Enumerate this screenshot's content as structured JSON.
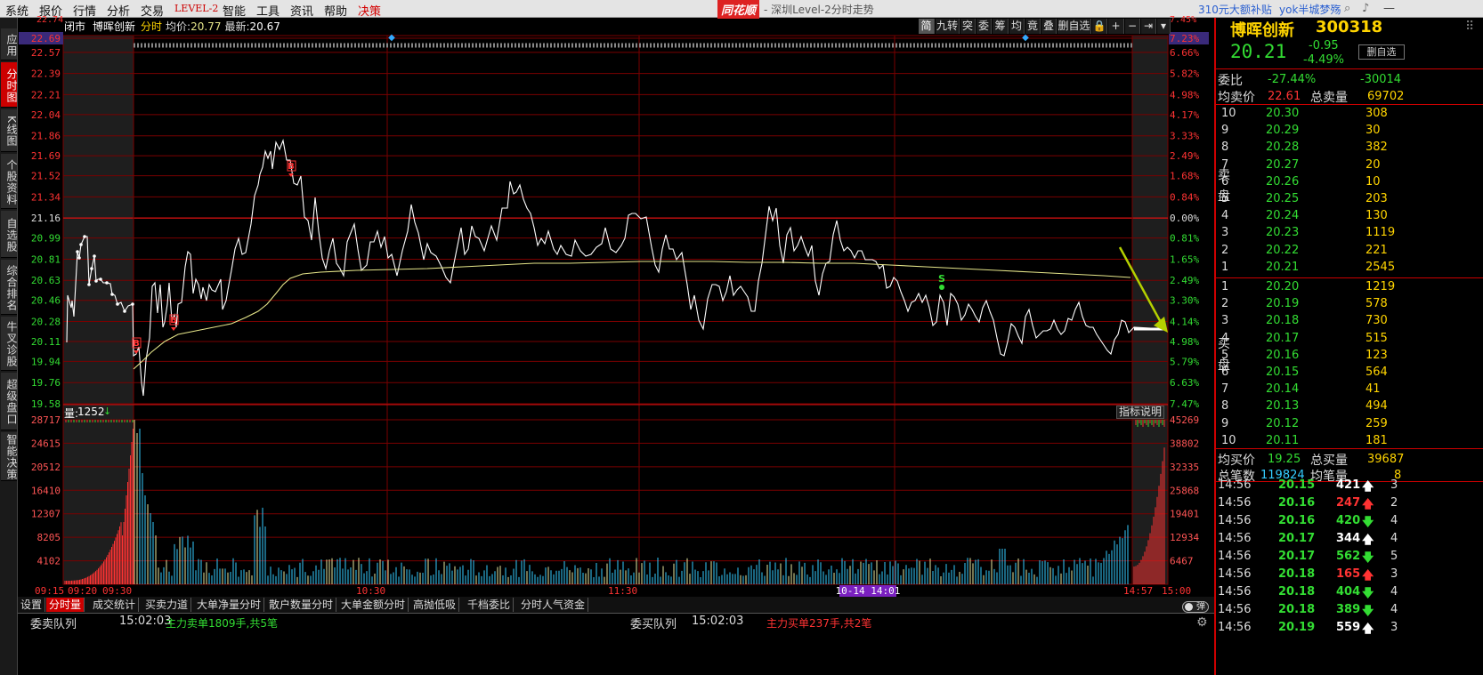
{
  "menu": {
    "items": [
      "系统",
      "报价",
      "行情",
      "分析",
      "交易",
      "LEVEL-2",
      "智能",
      "工具",
      "资讯",
      "帮助",
      "决策"
    ],
    "logo": "同花顺",
    "title": "深圳Level-2分时走势",
    "promo": "310元大额补贴",
    "user": "yok半城梦殇"
  },
  "left_tabs": [
    "应用",
    "分时图",
    "K线图",
    "个股资料",
    "自选股",
    "综合排名",
    "牛叉诊股",
    "超级盘口",
    "智能决策"
  ],
  "chart_header": {
    "session": "闭市",
    "name": "博晖创新",
    "mode": "分时",
    "avg_label": "均价:",
    "avg_value": "20.77",
    "latest_label": "最新:",
    "latest_value": "20.67"
  },
  "toolbar": [
    "简",
    "九转",
    "突",
    "委",
    "筹",
    "均",
    "竟",
    "叠",
    "删自选",
    "🔒",
    "+",
    "−",
    "⇥",
    "▾"
  ],
  "price_axis": {
    "prices": [
      "22.69",
      "22.57",
      "22.39",
      "22.21",
      "22.04",
      "21.86",
      "21.69",
      "21.52",
      "21.34",
      "21.16",
      "20.99",
      "20.81",
      "20.63",
      "20.46",
      "20.28",
      "20.11",
      "19.94",
      "19.76",
      "19.58"
    ],
    "percents": [
      "7.23%",
      "6.66%",
      "5.82%",
      "4.98%",
      "4.17%",
      "3.33%",
      "2.49%",
      "1.68%",
      "0.84%",
      "0.00%",
      "0.81%",
      "1.65%",
      "2.49%",
      "3.30%",
      "4.14%",
      "4.98%",
      "5.79%",
      "6.63%",
      "7.47%"
    ],
    "top_partial_left": "22.74",
    "top_partial_right": "7.45%"
  },
  "volume_axis": {
    "label": "量:",
    "value": "1252",
    "indicator_btn": "指标说明",
    "left": [
      "28717",
      "24615",
      "20512",
      "16410",
      "12307",
      "8205",
      "4102"
    ],
    "right": [
      "45269",
      "38802",
      "32335",
      "25868",
      "19401",
      "12934",
      "6467"
    ]
  },
  "time_axis": [
    "09:15",
    "09:20",
    "09:30",
    "10:30",
    "11:30",
    "14:57",
    "15:00"
  ],
  "time_cursor": "10-14 14:01",
  "markers": {
    "buy": "B",
    "sell": "S"
  },
  "bottom_tabs": [
    "设置",
    "分时量",
    "成交统计",
    "买卖力道",
    "大单净量分时",
    "散户数量分时",
    "大单金额分时",
    "高抛低吸",
    "千档委比",
    "分时人气资金"
  ],
  "queue": {
    "sell_title": "委卖队列",
    "sell_time": "15:02:03",
    "sell_info": "主力卖单1809手,共5笔",
    "buy_title": "委买队列",
    "buy_time": "15:02:03",
    "buy_info": "主力买单237手,共2笔",
    "toggle": "弹"
  },
  "quote": {
    "name": "博晖创新",
    "code": "300318",
    "price": "20.21",
    "change": "-0.95",
    "change_pct": "-4.49%",
    "btn": "删自选",
    "wei_bi_label": "委比",
    "wei_bi_value": "-27.44%",
    "wei_cha_value": "-30014",
    "avg_sell_label": "均卖价",
    "avg_sell_value": "22.61",
    "total_sell_label": "总卖量",
    "total_sell_value": "69702",
    "sell_side_label": "卖盘",
    "buy_side_label": "买盘",
    "sells": [
      {
        "lvl": "10",
        "price": "20.30",
        "vol": "308"
      },
      {
        "lvl": "9",
        "price": "20.29",
        "vol": "30"
      },
      {
        "lvl": "8",
        "price": "20.28",
        "vol": "382"
      },
      {
        "lvl": "7",
        "price": "20.27",
        "vol": "20"
      },
      {
        "lvl": "6",
        "price": "20.26",
        "vol": "10"
      },
      {
        "lvl": "5",
        "price": "20.25",
        "vol": "203"
      },
      {
        "lvl": "4",
        "price": "20.24",
        "vol": "130"
      },
      {
        "lvl": "3",
        "price": "20.23",
        "vol": "1119"
      },
      {
        "lvl": "2",
        "price": "20.22",
        "vol": "221"
      },
      {
        "lvl": "1",
        "price": "20.21",
        "vol": "2545"
      }
    ],
    "buys": [
      {
        "lvl": "1",
        "price": "20.20",
        "vol": "1219"
      },
      {
        "lvl": "2",
        "price": "20.19",
        "vol": "578"
      },
      {
        "lvl": "3",
        "price": "20.18",
        "vol": "730"
      },
      {
        "lvl": "4",
        "price": "20.17",
        "vol": "515"
      },
      {
        "lvl": "5",
        "price": "20.16",
        "vol": "123"
      },
      {
        "lvl": "6",
        "price": "20.15",
        "vol": "564"
      },
      {
        "lvl": "7",
        "price": "20.14",
        "vol": "41"
      },
      {
        "lvl": "8",
        "price": "20.13",
        "vol": "494"
      },
      {
        "lvl": "9",
        "price": "20.12",
        "vol": "259"
      },
      {
        "lvl": "10",
        "price": "20.11",
        "vol": "181"
      }
    ],
    "avg_buy_label": "均买价",
    "avg_buy_value": "19.25",
    "total_buy_label": "总买量",
    "total_buy_value": "39687",
    "total_trades_label": "总笔数",
    "total_trades_value": "119824",
    "avg_per_trade_label": "均笔量",
    "avg_per_trade_value": "8"
  },
  "ticks": [
    {
      "time": "14:56",
      "price": "20.15",
      "vol": "421",
      "dir": "up",
      "cnt": "3",
      "color": "#ffffff"
    },
    {
      "time": "14:56",
      "price": "20.16",
      "vol": "247",
      "dir": "up",
      "cnt": "2",
      "color": "#ff3333"
    },
    {
      "time": "14:56",
      "price": "20.16",
      "vol": "420",
      "dir": "down",
      "cnt": "4",
      "color": "#33dd33"
    },
    {
      "time": "14:56",
      "price": "20.17",
      "vol": "344",
      "dir": "up",
      "cnt": "4",
      "color": "#ffffff"
    },
    {
      "time": "14:56",
      "price": "20.17",
      "vol": "562",
      "dir": "down",
      "cnt": "5",
      "color": "#33dd33"
    },
    {
      "time": "14:56",
      "price": "20.18",
      "vol": "165",
      "dir": "up",
      "cnt": "3",
      "color": "#ff3333"
    },
    {
      "time": "14:56",
      "price": "20.18",
      "vol": "404",
      "dir": "down",
      "cnt": "4",
      "color": "#33dd33"
    },
    {
      "time": "14:56",
      "price": "20.18",
      "vol": "389",
      "dir": "down",
      "cnt": "4",
      "color": "#33dd33"
    },
    {
      "time": "14:56",
      "price": "20.19",
      "vol": "559",
      "dir": "up",
      "cnt": "3",
      "color": "#ffffff"
    }
  ],
  "colors": {
    "up": "#ff3333",
    "down": "#33dd33",
    "grid": "#7a0000",
    "price_line": "#ffffff",
    "avg_line": "#e6e68a",
    "accent": "#ffff00",
    "cyan": "#33ccff"
  }
}
